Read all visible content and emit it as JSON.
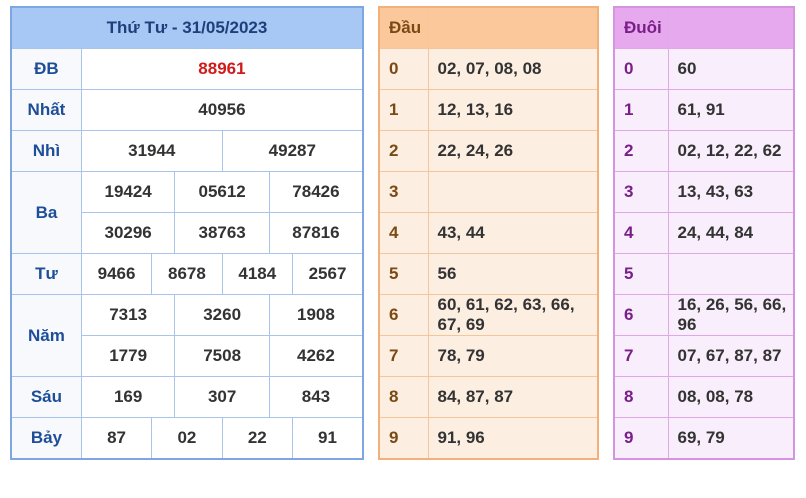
{
  "results": {
    "title": "Thứ Tư - 31/05/2023",
    "rows": [
      {
        "label": "ĐB",
        "nums": [
          "88961"
        ]
      },
      {
        "label": "Nhất",
        "nums": [
          "40956"
        ]
      },
      {
        "label": "Nhì",
        "nums": [
          "31944",
          "49287"
        ]
      },
      {
        "label": "Ba",
        "nums": [
          "19424",
          "05612",
          "78426",
          "30296",
          "38763",
          "87816"
        ]
      },
      {
        "label": "Tư",
        "nums": [
          "9466",
          "8678",
          "4184",
          "2567"
        ]
      },
      {
        "label": "Năm",
        "nums": [
          "7313",
          "3260",
          "1908",
          "1779",
          "7508",
          "4262"
        ]
      },
      {
        "label": "Sáu",
        "nums": [
          "169",
          "307",
          "843"
        ]
      },
      {
        "label": "Bảy",
        "nums": [
          "87",
          "02",
          "22",
          "91"
        ]
      }
    ]
  },
  "dau": {
    "header": "Đầu",
    "rows": [
      {
        "k": "0",
        "v": "02, 07, 08, 08"
      },
      {
        "k": "1",
        "v": "12, 13, 16"
      },
      {
        "k": "2",
        "v": "22, 24, 26"
      },
      {
        "k": "3",
        "v": ""
      },
      {
        "k": "4",
        "v": "43, 44"
      },
      {
        "k": "5",
        "v": "56"
      },
      {
        "k": "6",
        "v": "60, 61, 62, 63, 66, 67, 69"
      },
      {
        "k": "7",
        "v": "78, 79"
      },
      {
        "k": "8",
        "v": "84, 87, 87"
      },
      {
        "k": "9",
        "v": "91, 96"
      }
    ]
  },
  "duoi": {
    "header": "Đuôi",
    "rows": [
      {
        "k": "0",
        "v": "60"
      },
      {
        "k": "1",
        "v": "61, 91"
      },
      {
        "k": "2",
        "v": "02, 12, 22, 62"
      },
      {
        "k": "3",
        "v": "13, 43, 63"
      },
      {
        "k": "4",
        "v": "24, 44, 84"
      },
      {
        "k": "5",
        "v": ""
      },
      {
        "k": "6",
        "v": "16, 26, 56, 66, 96"
      },
      {
        "k": "7",
        "v": "07, 67, 87, 87"
      },
      {
        "k": "8",
        "v": "08, 08, 78"
      },
      {
        "k": "9",
        "v": "69, 79"
      }
    ]
  },
  "colors": {
    "special_prize": "#d21a1a",
    "results_header": "#a7c8f5",
    "dau_header": "#fbc89c",
    "duoi_header": "#e6a9ee"
  }
}
